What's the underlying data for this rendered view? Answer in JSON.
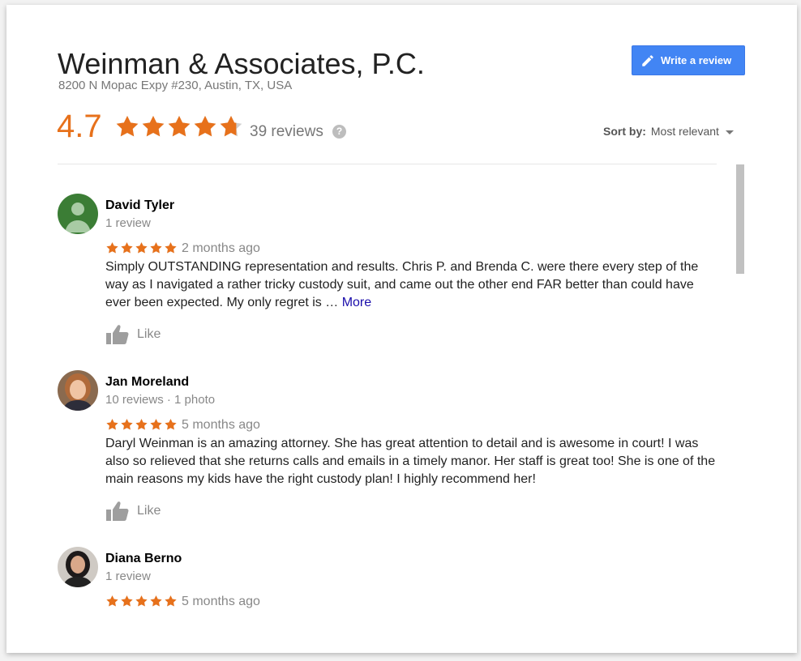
{
  "business": {
    "name": "Weinman & Associates, P.C.",
    "address": "8200 N Mopac Expy #230, Austin, TX, USA",
    "rating": "4.7",
    "rating_value": 4.7,
    "review_count": "39 reviews"
  },
  "actions": {
    "write_review": "Write a review"
  },
  "sort": {
    "label": "Sort by:",
    "value": "Most relevant"
  },
  "colors": {
    "star": "#e7711b",
    "star_empty": "#d0d0d0",
    "button": "#4285f4",
    "link": "#1a0dab"
  },
  "reviews": [
    {
      "name": "David Tyler",
      "meta": "1 review",
      "stars": 5,
      "time": "2 months ago",
      "text": "Simply OUTSTANDING representation and results. Chris P. and Brenda C. were there every step of the way as I navigated a rather tricky custody suit, and came out the other end FAR better than could have ever been expected. My only regret is … ",
      "more": "More",
      "like": "Like"
    },
    {
      "name": "Jan Moreland",
      "meta": "10 reviews · 1 photo",
      "stars": 5,
      "time": "5 months ago",
      "text": "Daryl Weinman is an amazing attorney.  She has great attention to detail and is awesome in court! I was also so relieved that she returns calls and emails in a timely manor.  Her staff is great too!  She is one of the main reasons my kids have the right custody plan!  I highly recommend her!",
      "like": "Like"
    },
    {
      "name": "Diana Berno",
      "meta": "1 review",
      "stars": 5,
      "time": "5 months ago"
    }
  ]
}
